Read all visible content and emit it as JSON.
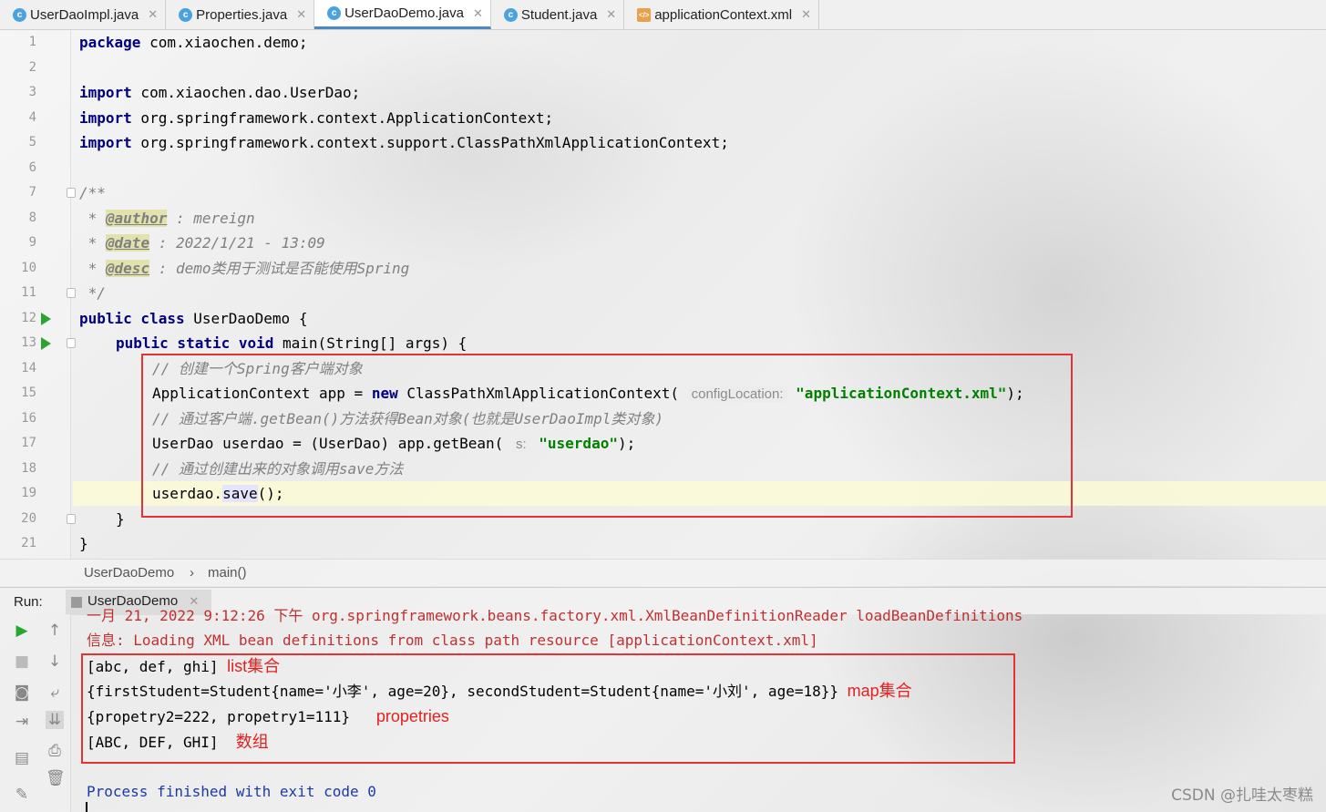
{
  "tabs": [
    {
      "name": "UserDaoImpl.java",
      "icon": "class-icon",
      "active": false
    },
    {
      "name": "Properties.java",
      "icon": "class-icon",
      "active": false
    },
    {
      "name": "UserDaoDemo.java",
      "icon": "class-icon",
      "active": true
    },
    {
      "name": "Student.java",
      "icon": "class-icon",
      "active": false
    },
    {
      "name": "applicationContext.xml",
      "icon": "xml-icon",
      "active": false
    }
  ],
  "code": {
    "line_numbers": [
      "1",
      "2",
      "3",
      "4",
      "5",
      "6",
      "7",
      "8",
      "9",
      "10",
      "11",
      "12",
      "13",
      "14",
      "15",
      "16",
      "17",
      "18",
      "19",
      "20",
      "21"
    ],
    "l1_kw": "package",
    "l1_rest": " com.xiaochen.demo;",
    "l3_kw": "import",
    "l3_rest": " com.xiaochen.dao.UserDao;",
    "l4_kw": "import",
    "l4_rest": " org.springframework.context.ApplicationContext;",
    "l5_kw": "import",
    "l5_rest": " org.springframework.context.support.ClassPathXmlApplicationContext;",
    "l7": "/**",
    "l8_pre": " * ",
    "l8_tag": "@author",
    "l8_rest": " : mereign",
    "l9_pre": " * ",
    "l9_tag": "@date",
    "l9_rest": " : 2022/1/21 - 13:09",
    "l10_pre": " * ",
    "l10_tag": "@desc",
    "l10_rest": " : demo类用于测试是否能使用Spring",
    "l11": " */",
    "l12_kw": "public class",
    "l12_rest": " UserDaoDemo {",
    "l13_kw": "public static void",
    "l13_rest": " main(String[] args) {",
    "l14": "// 创建一个Spring客户端对象",
    "l15_a": "ApplicationContext app = ",
    "l15_kw": "new",
    "l15_b": " ClassPathXmlApplicationContext(",
    "l15_hint": "configLocation:",
    "l15_str": "\"applicationContext.xml\"",
    "l15_c": ");",
    "l16": "// 通过客户端.getBean()方法获得Bean对象(也就是UserDaoImpl类对象)",
    "l17_a": "UserDao userdao = (UserDao) app.getBean(",
    "l17_hint": "s:",
    "l17_str": "\"userdao\"",
    "l17_c": ");",
    "l18": "// 通过创建出来的对象调用save方法",
    "l19_a": "userdao.",
    "l19_m": "save",
    "l19_c": "();",
    "l20": "}",
    "l21": "}"
  },
  "breadcrumb": {
    "class": "UserDaoDemo",
    "sep": "›",
    "method": "main()"
  },
  "run": {
    "label": "Run:",
    "tab": "UserDaoDemo",
    "console": {
      "log1": "一月 21, 2022 9:12:26 下午 org.springframework.beans.factory.xml.XmlBeanDefinitionReader loadBeanDefinitions",
      "log2": "信息: Loading XML bean definitions from class path resource [applicationContext.xml]",
      "out1": "[abc, def, ghi]",
      "out2": "{firstStudent=Student{name='小李', age=20}, secondStudent=Student{name='小刘', age=18}}",
      "out3": "{propetry2=222, propetry1=111}",
      "out4": "[ABC, DEF, GHI]",
      "finish": "Process finished with exit code 0"
    },
    "annotations": {
      "a1": "list集合",
      "a2": "map集合",
      "a3": "propetries",
      "a4": "数组"
    }
  },
  "watermark": "CSDN @扎哇太枣糕",
  "colors": {
    "keyword": "#000080",
    "comment": "#808080",
    "string": "#007f00",
    "annotation_red": "#e42020",
    "highlight_box": "#e53333",
    "tab_accent": "#4a88c7"
  }
}
